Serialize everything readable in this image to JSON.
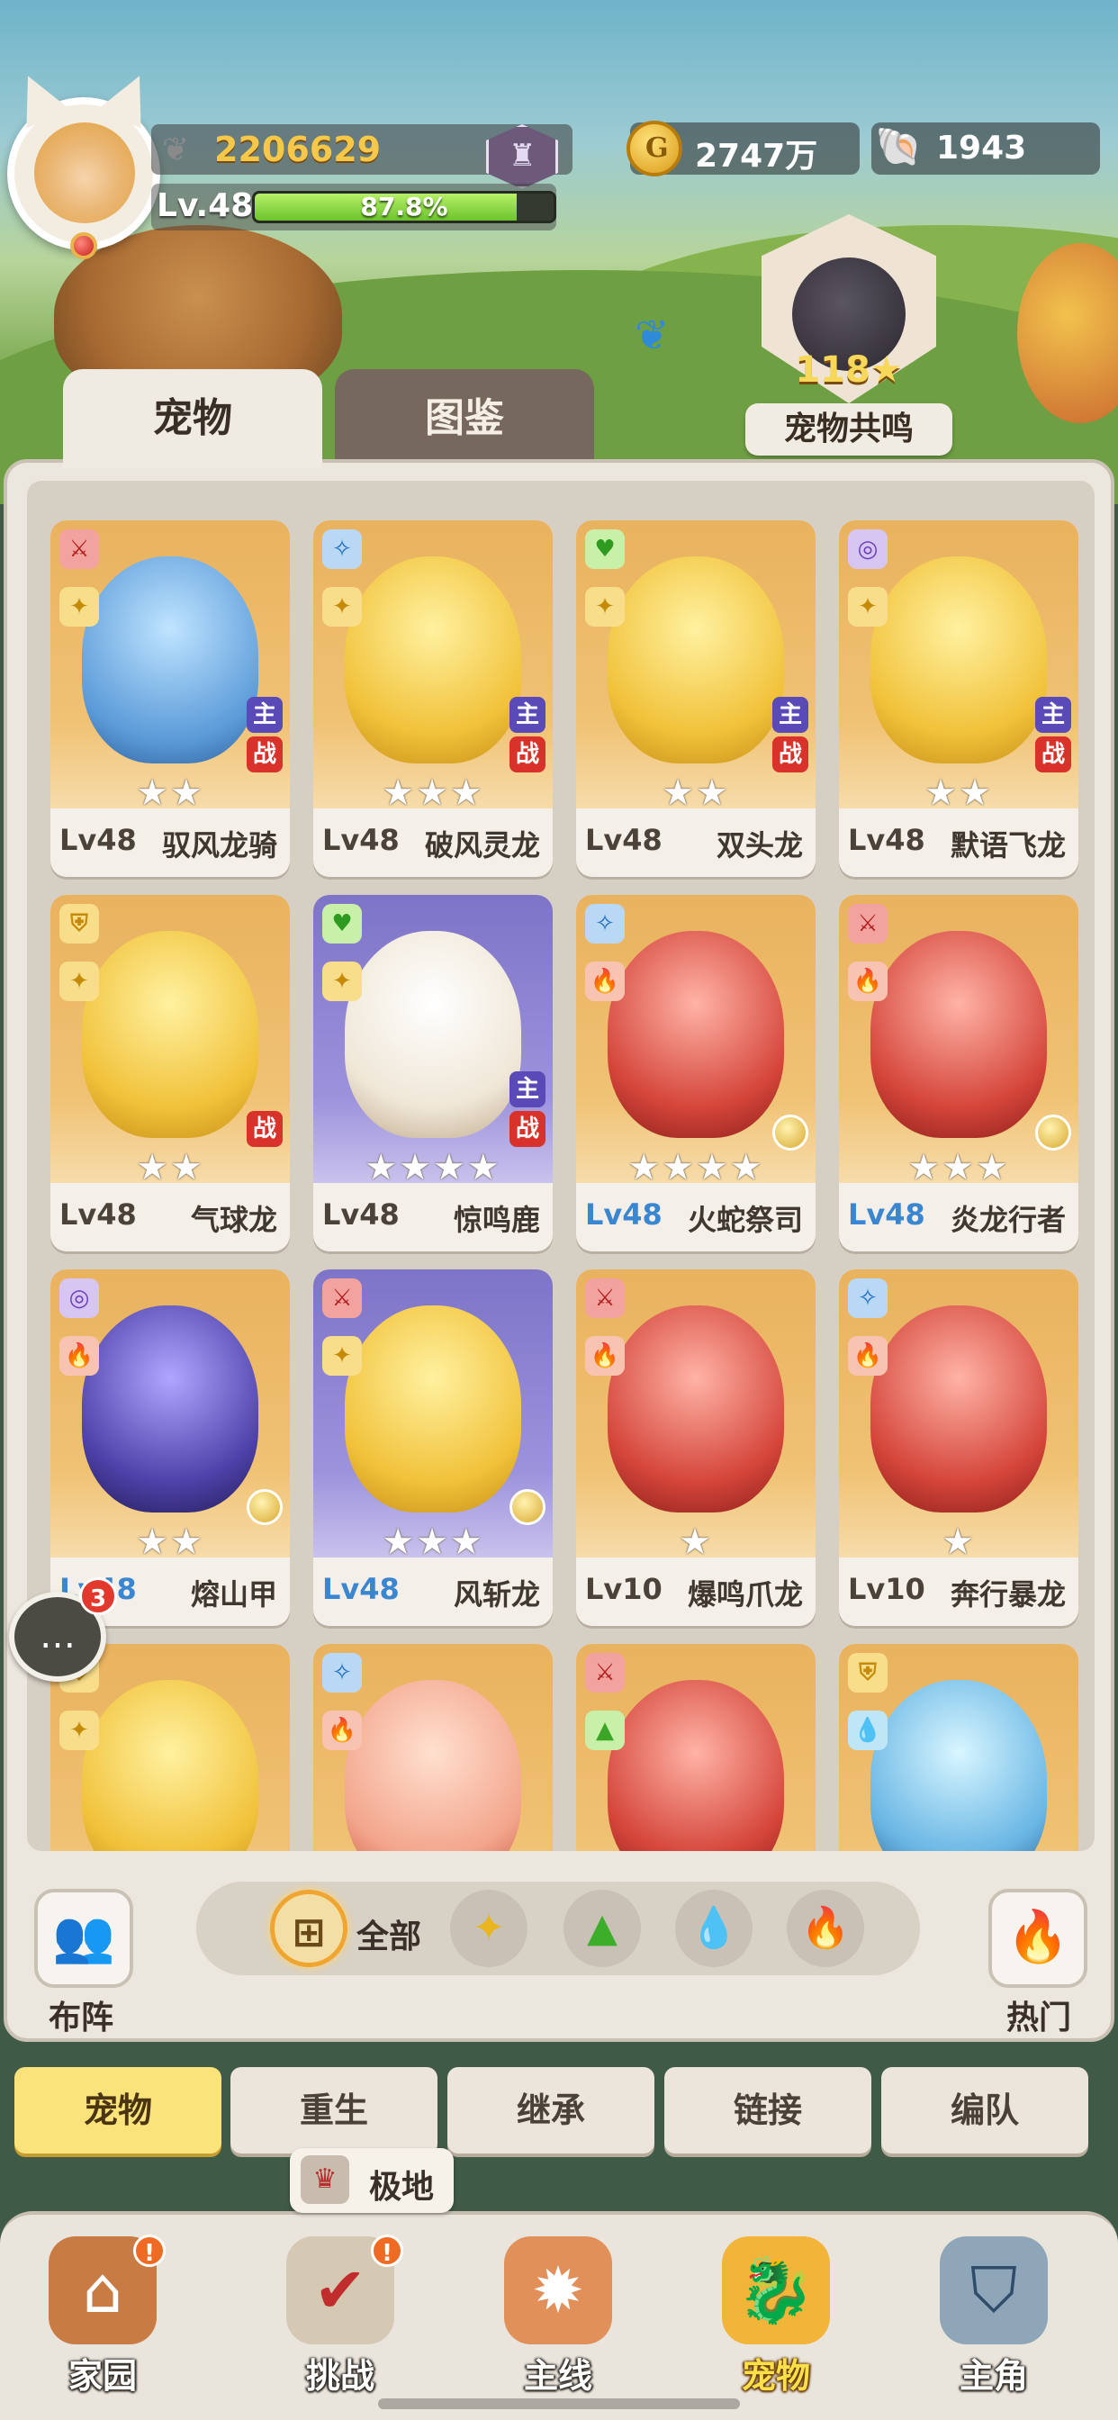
{
  "player": {
    "power": "2206629",
    "level_label": "Lv.48",
    "xp_text": "87.8%",
    "xp_fraction": 0.878
  },
  "currencies": {
    "gold": "2747万",
    "shell": "1943"
  },
  "resonance": {
    "count": "118★",
    "label": "宠物共鸣"
  },
  "tabs": {
    "pets": "宠物",
    "atlas": "图鉴"
  },
  "pets": [
    {
      "level": "Lv48",
      "name": "驭风龙骑",
      "stars": "★★",
      "class_icon": "sword-icon",
      "class_glyph": "⚔",
      "class_style": "badge-red",
      "elem_glyph": "✦",
      "elem_style": "badge-gold",
      "main": "主",
      "battle": "战",
      "color": "pet-blue"
    },
    {
      "level": "Lv48",
      "name": "破风灵龙",
      "stars": "★★★",
      "class_icon": "magic-icon",
      "class_glyph": "✧",
      "class_style": "badge-blue",
      "elem_glyph": "✦",
      "elem_style": "badge-gold",
      "main": "主",
      "battle": "战",
      "color": "pet-yellow"
    },
    {
      "level": "Lv48",
      "name": "双头龙",
      "stars": "★★",
      "class_icon": "heal-icon",
      "class_glyph": "♥",
      "class_style": "badge-green",
      "elem_glyph": "✦",
      "elem_style": "badge-gold",
      "main": "主",
      "battle": "战",
      "color": "pet-yellow"
    },
    {
      "level": "Lv48",
      "name": "默语飞龙",
      "stars": "★★",
      "class_icon": "spiral-icon",
      "class_glyph": "◎",
      "class_style": "badge-purple",
      "elem_glyph": "✦",
      "elem_style": "badge-gold",
      "main": "主",
      "battle": "战",
      "color": "pet-yellow"
    },
    {
      "level": "Lv48",
      "name": "气球龙",
      "stars": "★★",
      "class_icon": "shield-icon",
      "class_glyph": "⛨",
      "class_style": "badge-gold",
      "elem_glyph": "✦",
      "elem_style": "badge-gold",
      "battle": "战",
      "color": "pet-yellow"
    },
    {
      "level": "Lv48",
      "name": "惊鸣鹿",
      "stars": "★★★★",
      "class_icon": "heal-icon",
      "class_glyph": "♥",
      "class_style": "badge-green",
      "elem_glyph": "✦",
      "elem_style": "badge-gold",
      "main": "主",
      "battle": "战",
      "color": "pet-white",
      "purple": true
    },
    {
      "level": "Lv48",
      "name": "火蛇祭司",
      "stars": "★★★★",
      "class_icon": "magic-icon",
      "class_glyph": "✧",
      "class_style": "badge-blue",
      "elem_glyph": "🔥",
      "elem_style": "badge-fire",
      "medal": true,
      "lv_blue": true,
      "color": "pet-red"
    },
    {
      "level": "Lv48",
      "name": "炎龙行者",
      "stars": "★★★",
      "class_icon": "sword-icon",
      "class_glyph": "⚔",
      "class_style": "badge-red",
      "elem_glyph": "🔥",
      "elem_style": "badge-fire",
      "medal": true,
      "lv_blue": true,
      "color": "pet-red"
    },
    {
      "level": "Lv48",
      "name": "熔山甲",
      "stars": "★★",
      "class_icon": "spiral-icon",
      "class_glyph": "◎",
      "class_style": "badge-purple",
      "elem_glyph": "🔥",
      "elem_style": "badge-fire",
      "medal": true,
      "lv_blue": true,
      "color": "pet-dark"
    },
    {
      "level": "Lv48",
      "name": "风斩龙",
      "stars": "★★★",
      "class_icon": "sword-icon",
      "class_glyph": "⚔",
      "class_style": "badge-red",
      "elem_glyph": "✦",
      "elem_style": "badge-gold",
      "medal": true,
      "lv_blue": true,
      "color": "pet-yellow",
      "purple": true
    },
    {
      "level": "Lv10",
      "name": "爆鸣爪龙",
      "stars": "★",
      "class_icon": "sword-icon",
      "class_glyph": "⚔",
      "class_style": "badge-red",
      "elem_glyph": "🔥",
      "elem_style": "badge-fire",
      "color": "pet-red"
    },
    {
      "level": "Lv10",
      "name": "奔行暴龙",
      "stars": "★",
      "class_icon": "magic-icon",
      "class_glyph": "✧",
      "class_style": "badge-blue",
      "elem_glyph": "🔥",
      "elem_style": "badge-fire",
      "color": "pet-red"
    },
    {
      "level": "",
      "name": "",
      "stars": "",
      "class_icon": "shield-icon",
      "class_glyph": "⛨",
      "class_style": "badge-gold",
      "elem_glyph": "✦",
      "elem_style": "badge-gold",
      "color": "pet-yellow"
    },
    {
      "level": "",
      "name": "",
      "stars": "",
      "class_icon": "magic-icon",
      "class_glyph": "✧",
      "class_style": "badge-blue",
      "elem_glyph": "🔥",
      "elem_style": "badge-fire",
      "color": "pet-pink"
    },
    {
      "level": "",
      "name": "",
      "stars": "",
      "class_icon": "sword-icon",
      "class_glyph": "⚔",
      "class_style": "badge-red",
      "elem_glyph": "▲",
      "elem_style": "badge-earth",
      "color": "pet-red"
    },
    {
      "level": "",
      "name": "",
      "stars": "",
      "class_icon": "shield-icon",
      "class_glyph": "⛨",
      "class_style": "badge-gold",
      "elem_glyph": "💧",
      "elem_style": "badge-water",
      "color": "pet-ice"
    }
  ],
  "chat": {
    "unread": "3"
  },
  "filters": {
    "formation_label": "布阵",
    "all_label": "全部",
    "hot_label": "热门",
    "elements": [
      "wind-element-icon",
      "earth-element-icon",
      "water-element-icon",
      "fire-element-icon"
    ]
  },
  "subtabs": [
    "宠物",
    "重生",
    "继承",
    "链接",
    "编队"
  ],
  "tooltip": {
    "label": "极地"
  },
  "bottom_nav": [
    {
      "label": "家园",
      "icon": "home-icon",
      "alert": "!"
    },
    {
      "label": "挑战",
      "icon": "challenge-icon",
      "alert": "!"
    },
    {
      "label": "主线",
      "icon": "mainline-icon"
    },
    {
      "label": "宠物",
      "icon": "pet-dragon-icon",
      "active": true
    },
    {
      "label": "主角",
      "icon": "hero-icon"
    }
  ]
}
